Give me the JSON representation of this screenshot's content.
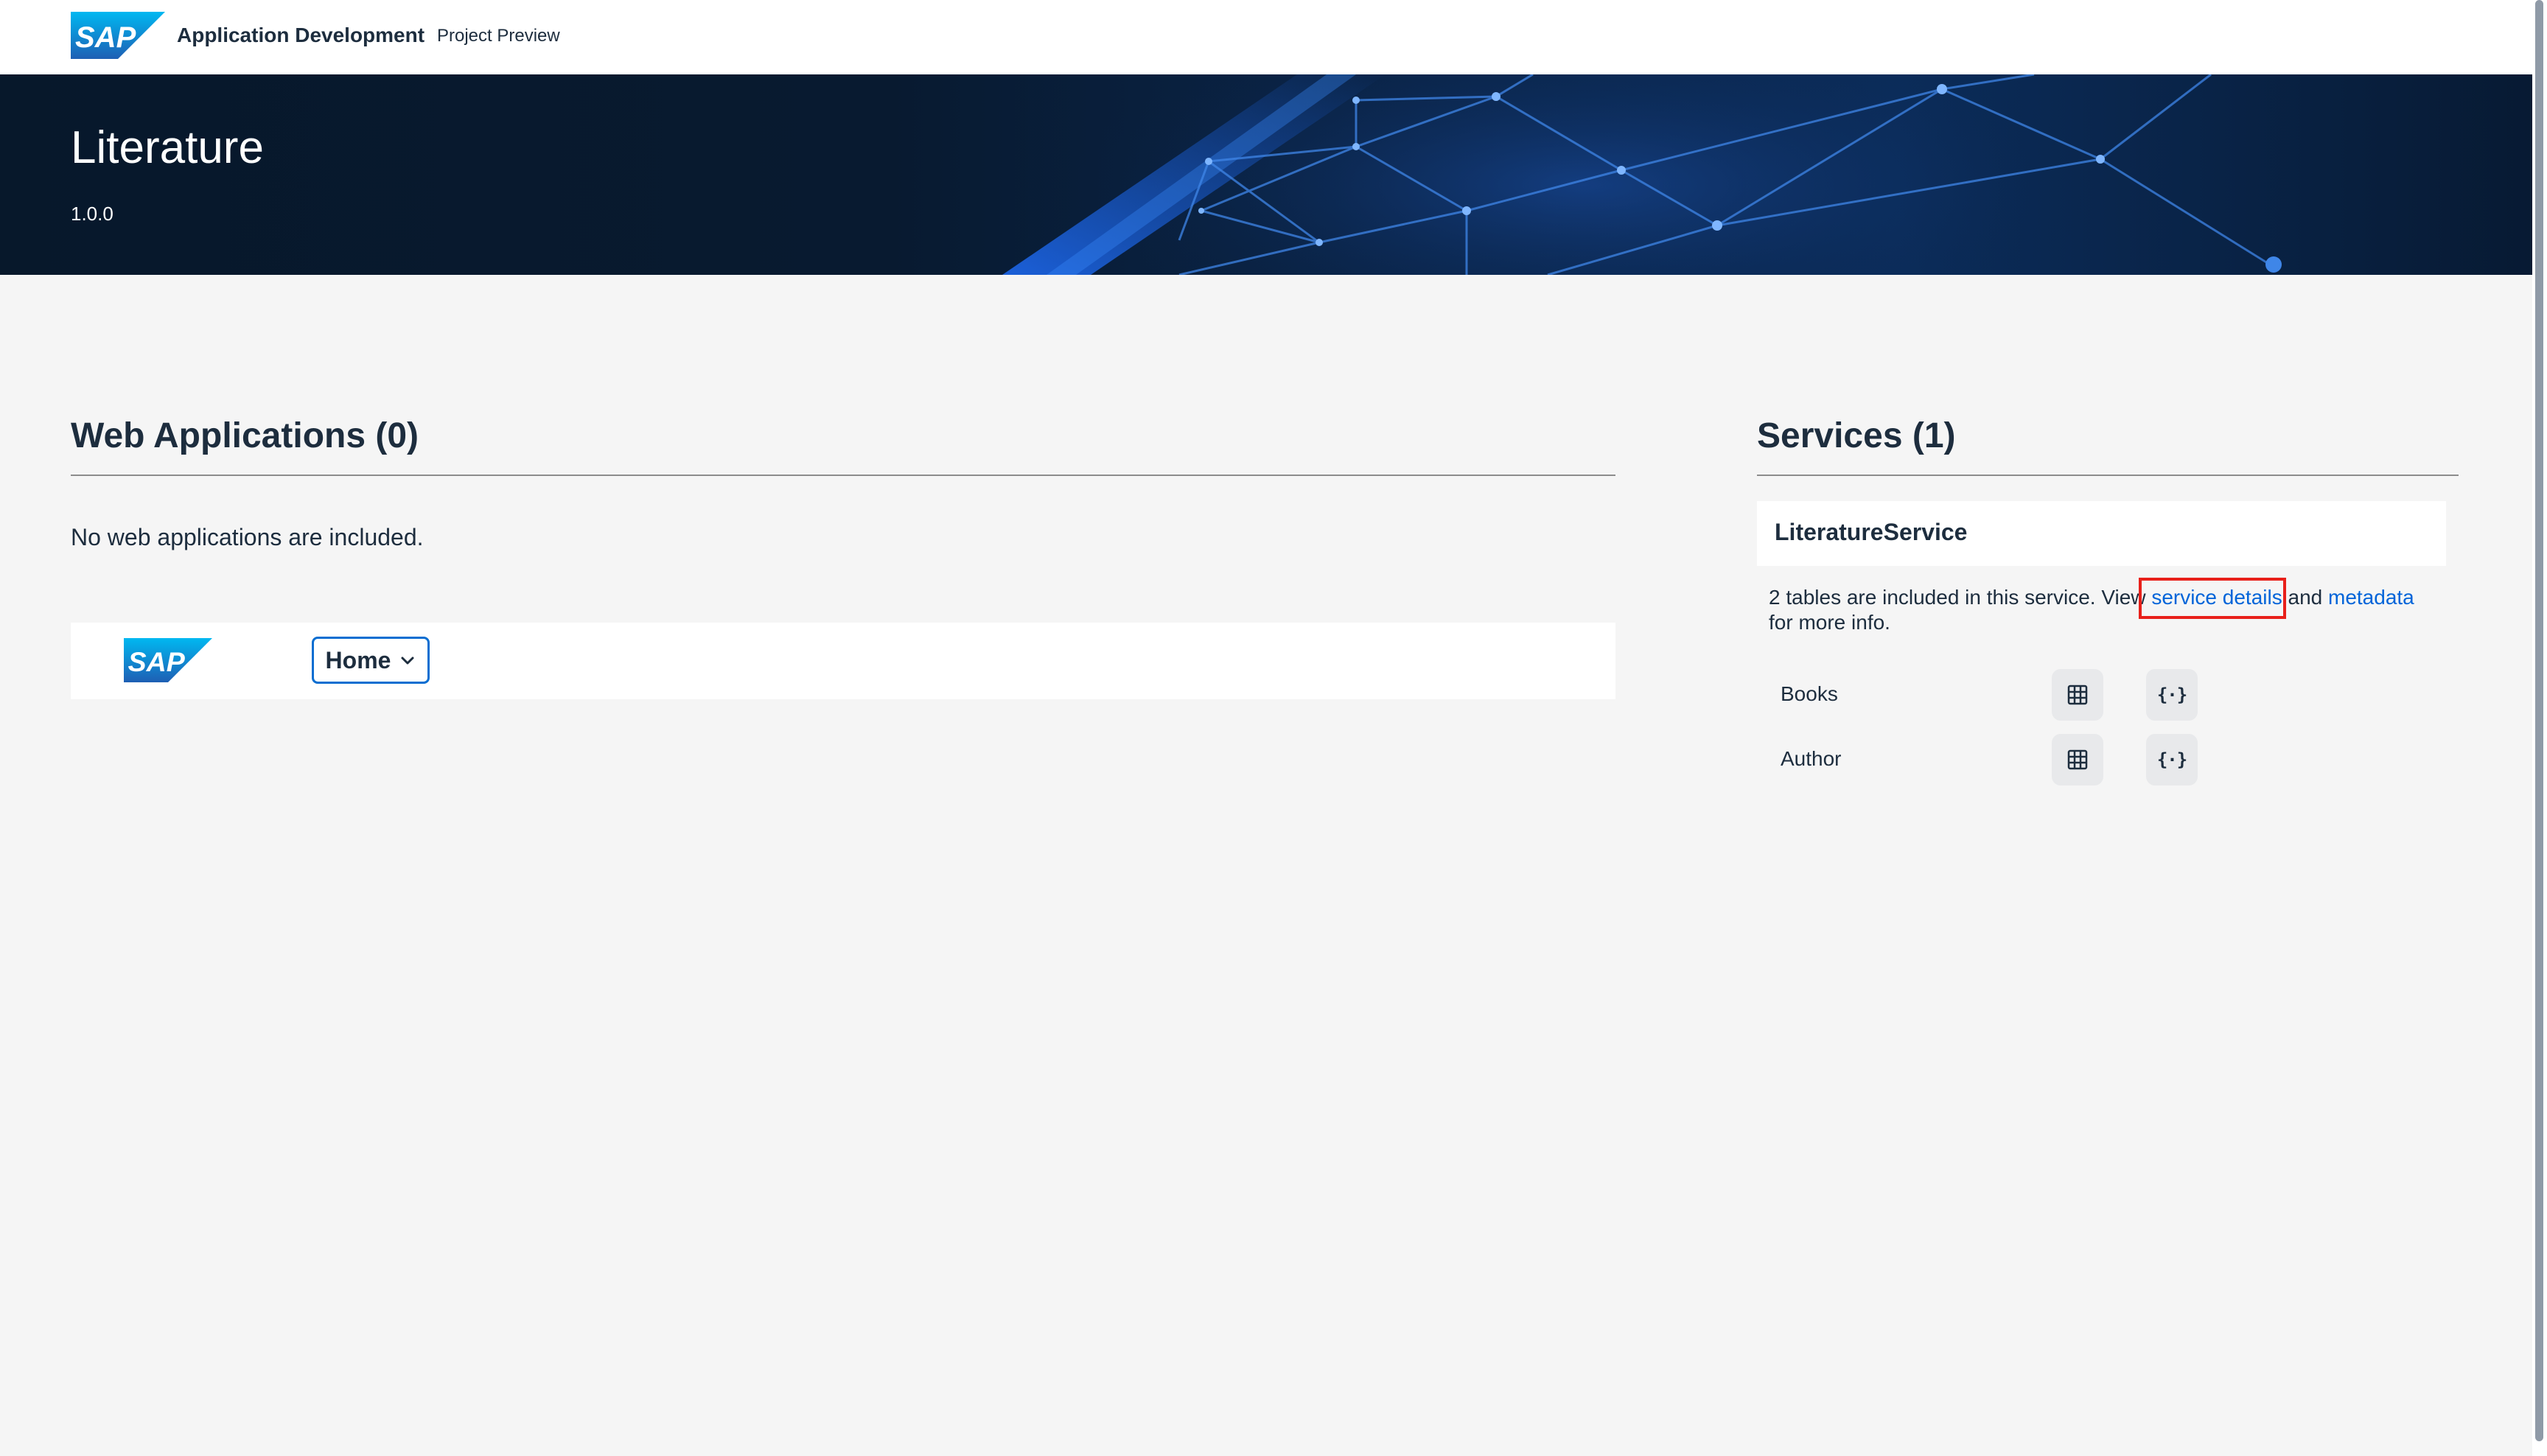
{
  "shellbar": {
    "logo": "SAP",
    "title": "Application Development",
    "subtitle": "Project Preview"
  },
  "hero": {
    "title": "Literature",
    "version": "1.0.0"
  },
  "web_applications": {
    "heading": "Web Applications (0)",
    "empty_message": "No web applications are included.",
    "preview_bar": {
      "logo": "SAP",
      "menu_label": "Home",
      "menu_icon": "chevron-down-icon"
    }
  },
  "services": {
    "heading": "Services (1)",
    "items": [
      {
        "name": "LiteratureService",
        "description_prefix": "2 tables are included in this service. View ",
        "service_details_link": "service details",
        "description_middle": " and ",
        "metadata_link": "metadata",
        "description_suffix": " for more info.",
        "entities": [
          {
            "name": "Books",
            "table_icon": "table-icon",
            "json_icon": "json-braces-icon"
          },
          {
            "name": "Author",
            "table_icon": "table-icon",
            "json_icon": "json-braces-icon"
          }
        ]
      }
    ]
  },
  "colors": {
    "sap_blue_light": "#00b8f1",
    "sap_blue_dark": "#1e5fb4",
    "link": "#0064d9",
    "highlight_box": "#e8201a",
    "button_border": "#0a6ed1",
    "page_background": "#f5f5f5"
  }
}
